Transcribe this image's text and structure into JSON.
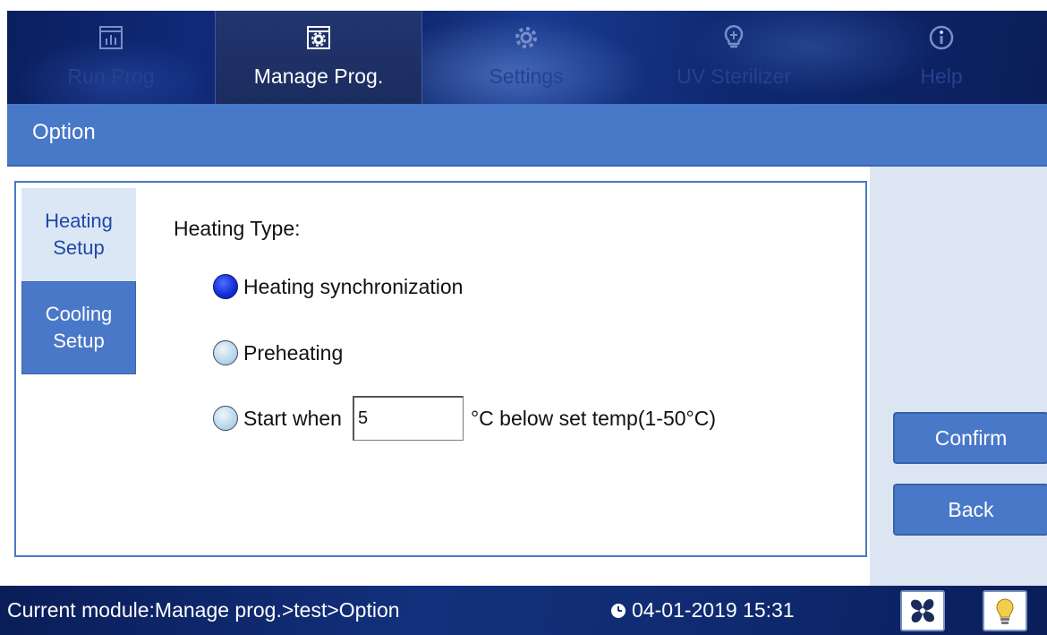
{
  "nav": {
    "tabs": [
      {
        "label": "Run Prog",
        "icon": "chart-window-icon"
      },
      {
        "label": "Manage Prog.",
        "icon": "gear-window-icon"
      },
      {
        "label": "Settings",
        "icon": "gear-icon"
      },
      {
        "label": "UV Sterilizer",
        "icon": "lightbulb-icon"
      },
      {
        "label": "Help",
        "icon": "info-icon"
      }
    ],
    "active_index": 1
  },
  "header": {
    "title": "Option"
  },
  "side_tabs": [
    {
      "label_line1": "Heating",
      "label_line2": "Setup"
    },
    {
      "label_line1": "Cooling",
      "label_line2": "Setup"
    }
  ],
  "heating": {
    "type_label": "Heating Type:",
    "options": [
      {
        "label": "Heating synchronization",
        "selected": true
      },
      {
        "label": "Preheating",
        "selected": false
      },
      {
        "label": "Start when",
        "selected": false
      }
    ],
    "start_when_value": "5",
    "start_when_suffix": "°C below set temp(1-50°C)"
  },
  "actions": {
    "confirm_label": "Confirm",
    "back_label": "Back"
  },
  "status": {
    "module_text": "Current module:Manage prog.>test>Option",
    "datetime": "04-01-2019 15:31"
  },
  "colors": {
    "accent": "#4878c8",
    "nav_background": "#0c2265",
    "radio_selected": "#1530d8",
    "panel_right": "#dce6f2"
  }
}
